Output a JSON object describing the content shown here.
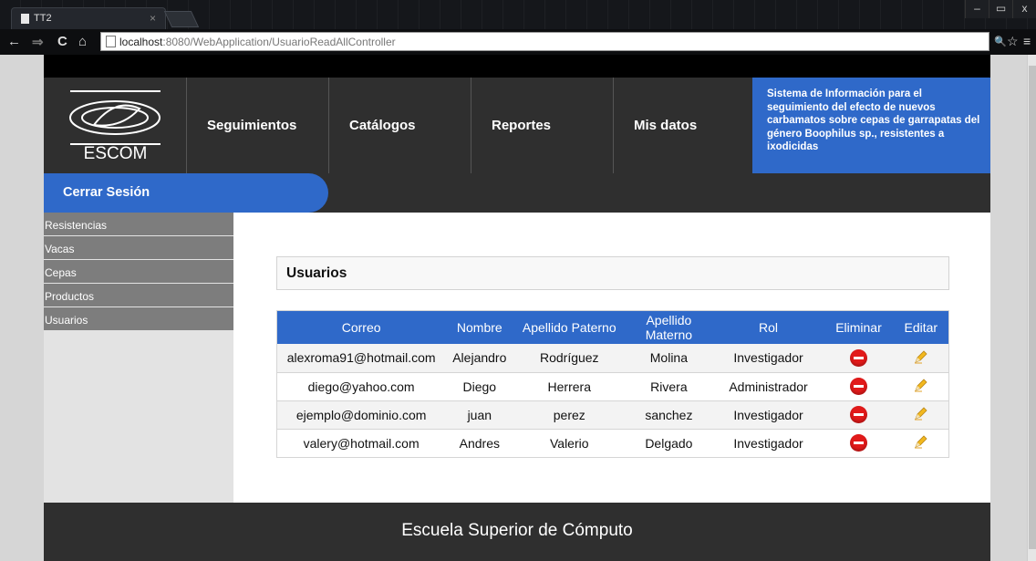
{
  "browser": {
    "tab_title": "TT2",
    "tab_close": "×",
    "url_host": "localhost",
    "url_rest": ":8080/WebApplication/UsuarioReadAllController",
    "back": "←",
    "forward": "⇒",
    "reload": "C",
    "home": "⌂",
    "minimize": "–",
    "maximize": "▭",
    "close": "x",
    "zoom": "🔍",
    "star": "☆",
    "menu": "≡"
  },
  "header": {
    "logo_text": "ESCOM",
    "menu": [
      {
        "label": "Seguimientos"
      },
      {
        "label": "Catálogos"
      },
      {
        "label": "Reportes"
      },
      {
        "label": "Mis datos"
      }
    ],
    "info": "Sistema de Información para el seguimiento del efecto de nuevos carbamatos sobre cepas de garrapatas del género Boophilus sp., resistentes a ixodicidas",
    "colors": {
      "accent": "#2f69c9",
      "dark": "#2f2f2f"
    }
  },
  "session": {
    "logout_label": "Cerrar Sesión"
  },
  "sidebar": {
    "items": [
      {
        "label": "Resistencias"
      },
      {
        "label": "Vacas"
      },
      {
        "label": "Cepas"
      },
      {
        "label": "Productos"
      },
      {
        "label": "Usuarios"
      }
    ]
  },
  "main": {
    "title": "Usuarios",
    "table": {
      "columns": [
        "Correo",
        "Nombre",
        "Apellido Paterno",
        "Apellido Materno",
        "Rol",
        "Eliminar",
        "Editar"
      ],
      "rows": [
        {
          "correo": "alexroma91@hotmail.com",
          "nombre": "Alejandro",
          "paterno": "Rodríguez",
          "materno": "Molina",
          "rol": "Investigador",
          "delete_icon": "delete-icon",
          "edit_icon": "pencil-icon"
        },
        {
          "correo": "diego@yahoo.com",
          "nombre": "Diego",
          "paterno": "Herrera",
          "materno": "Rivera",
          "rol": "Administrador",
          "delete_icon": "delete-icon",
          "edit_icon": "pencil-icon"
        },
        {
          "correo": "ejemplo@dominio.com",
          "nombre": "juan",
          "paterno": "perez",
          "materno": "sanchez",
          "rol": "Investigador",
          "delete_icon": "delete-icon",
          "edit_icon": "pencil-icon"
        },
        {
          "correo": "valery@hotmail.com",
          "nombre": "Andres",
          "paterno": "Valerio",
          "materno": "Delgado",
          "rol": "Investigador",
          "delete_icon": "delete-icon",
          "edit_icon": "pencil-icon"
        }
      ]
    }
  },
  "footer": {
    "text": "Escuela Superior de Cómputo"
  }
}
